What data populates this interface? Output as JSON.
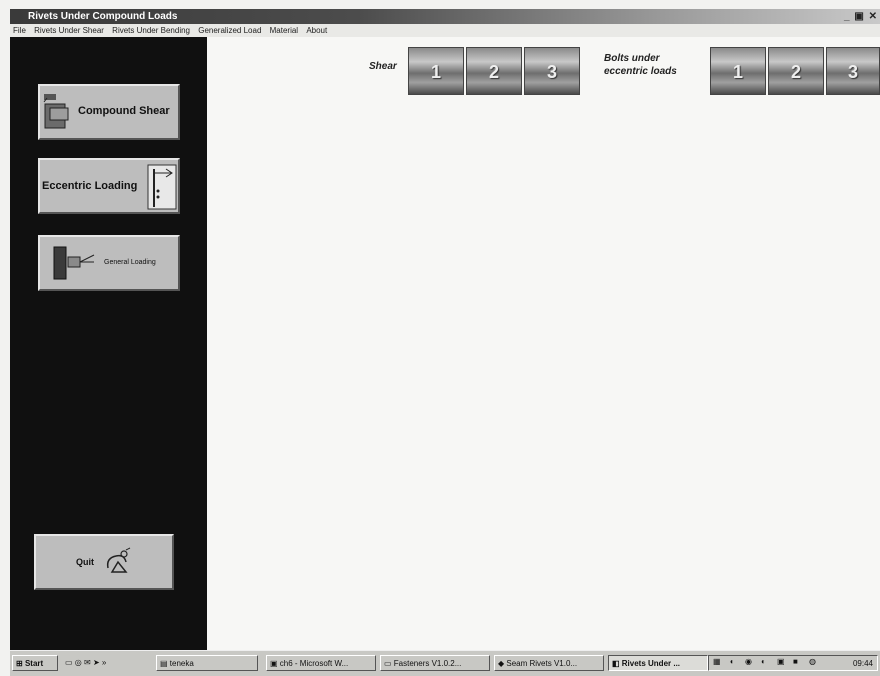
{
  "window": {
    "title": "Rivets Under Compound Loads",
    "controls": "_ ▣ ✕"
  },
  "menu": [
    "File",
    "Rivets Under Shear",
    "Rivets Under Bending",
    "Generalized Load",
    "Material",
    "About"
  ],
  "sidebar": {
    "compound_shear_label": "Compound Shear",
    "eccentric_loading_label": "Eccentric Loading",
    "general_loading_label": "General Loading",
    "quit_label": "Quit"
  },
  "tabs": {
    "shear_label": "Shear",
    "bolts_label_line1": "Bolts under",
    "bolts_label_line2": "eccentric loads",
    "shear_tabs": [
      "1",
      "2",
      "3"
    ],
    "bolts_tabs": [
      "1",
      "2",
      "3"
    ]
  },
  "taskbar": {
    "start_label": "Start",
    "quick_launch": "»",
    "items": [
      {
        "label": "teneka",
        "active": false
      },
      {
        "label": "ch6 - Microsoft W...",
        "active": false
      },
      {
        "label": "Fasteners V1.0.2...",
        "active": false
      },
      {
        "label": "Seam Rivets V1.0...",
        "active": false
      },
      {
        "label": "Rivets Under ...",
        "active": true
      }
    ],
    "clock": "09:44"
  },
  "colors": {
    "sidebar_bg": "#101010",
    "button_face": "#bdbdbd",
    "titlebar_dark": "#3a3a3a"
  }
}
